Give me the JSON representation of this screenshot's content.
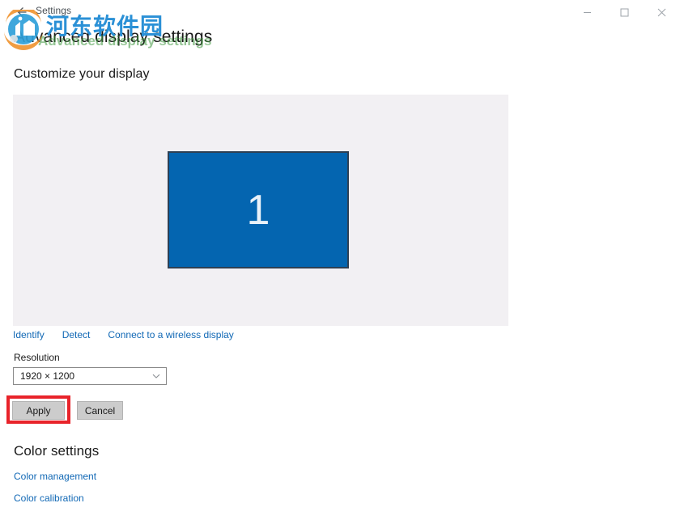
{
  "window": {
    "app_title": "Settings",
    "back_icon": "back-arrow-icon",
    "controls": {
      "minimize_label": "–",
      "maximize_label": "□",
      "close_label": "✕"
    }
  },
  "page": {
    "title": "Advanced display settings"
  },
  "customize": {
    "heading": "Customize your display",
    "monitor_number": "1",
    "monitor_color": "#0465b0",
    "links": [
      {
        "label": "Identify",
        "name": "identify-link"
      },
      {
        "label": "Detect",
        "name": "detect-link"
      },
      {
        "label": "Connect to a wireless display",
        "name": "connect-wireless-display-link"
      }
    ]
  },
  "resolution": {
    "label": "Resolution",
    "selected": "1920 × 1200",
    "chevron_icon": "chevron-down-icon"
  },
  "actions": {
    "apply_label": "Apply",
    "cancel_label": "Cancel",
    "highlight_color": "#e8232a"
  },
  "color_settings": {
    "heading": "Color settings",
    "links": [
      {
        "label": "Color management",
        "name": "color-management-link"
      },
      {
        "label": "Color calibration",
        "name": "color-calibration-link"
      }
    ]
  },
  "watermark": {
    "brand_text": "河东软件园",
    "sub_text": "Advanced display settings",
    "brand_color": "#2a90d6"
  }
}
